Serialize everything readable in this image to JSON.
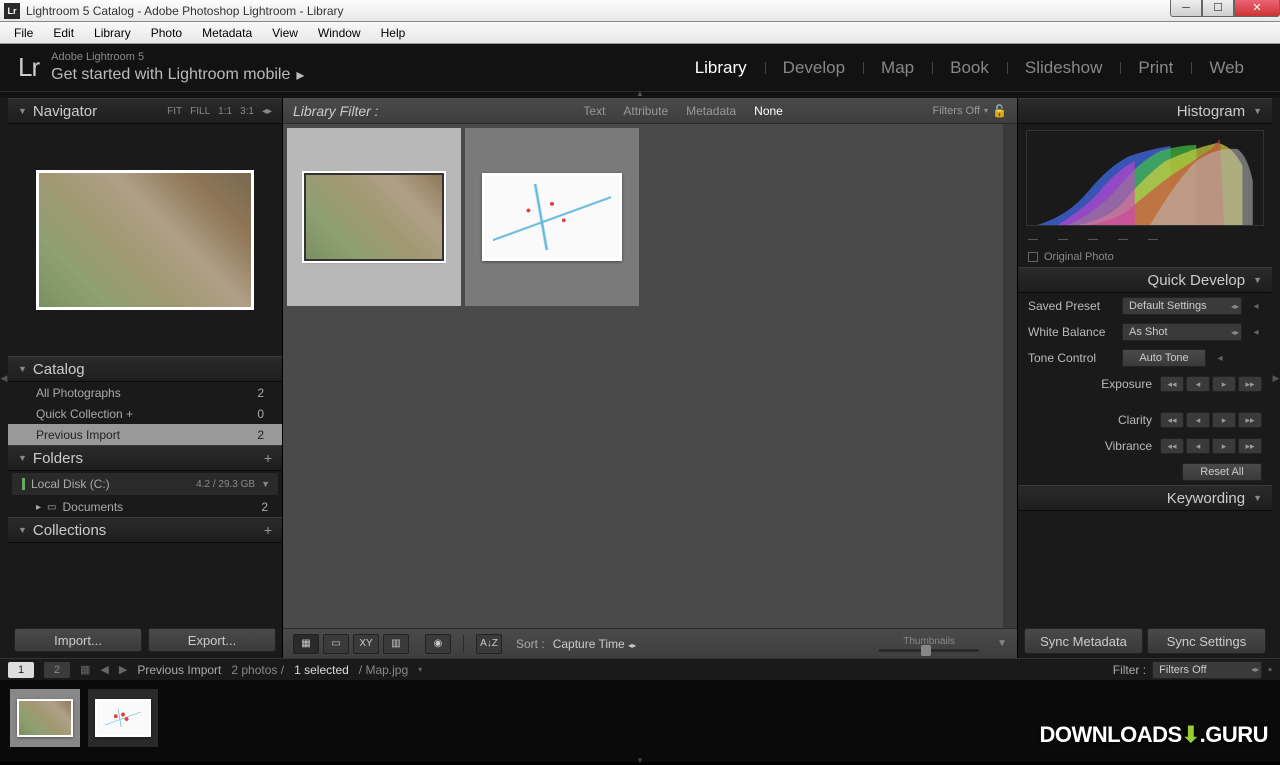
{
  "window": {
    "title": "Lightroom 5 Catalog - Adobe Photoshop Lightroom - Library",
    "lr_badge": "Lr"
  },
  "menu": [
    "File",
    "Edit",
    "Library",
    "Photo",
    "Metadata",
    "View",
    "Window",
    "Help"
  ],
  "header": {
    "logo": "Lr",
    "subtitle": "Adobe Lightroom 5",
    "tagline": "Get started with Lightroom mobile",
    "modules": [
      "Library",
      "Develop",
      "Map",
      "Book",
      "Slideshow",
      "Print",
      "Web"
    ],
    "active_module": "Library"
  },
  "left": {
    "navigator": {
      "title": "Navigator",
      "zoom": [
        "FIT",
        "FILL",
        "1:1",
        "3:1"
      ]
    },
    "catalog": {
      "title": "Catalog",
      "items": [
        {
          "label": "All Photographs",
          "count": "2"
        },
        {
          "label": "Quick Collection  +",
          "count": "0"
        },
        {
          "label": "Previous Import",
          "count": "2"
        }
      ],
      "selected_index": 2
    },
    "folders": {
      "title": "Folders",
      "disk": {
        "label": "Local Disk (C:)",
        "size": "4.2 / 29.3 GB"
      },
      "sub": {
        "label": "Documents",
        "count": "2"
      }
    },
    "collections": {
      "title": "Collections"
    },
    "buttons": {
      "import": "Import...",
      "export": "Export..."
    }
  },
  "filter": {
    "label": "Library Filter :",
    "tabs": [
      "Text",
      "Attribute",
      "Metadata",
      "None"
    ],
    "active": "None",
    "off": "Filters Off"
  },
  "toolbar": {
    "sort_label": "Sort :",
    "sort_value": "Capture Time",
    "thumb_label": "Thumbnails"
  },
  "right": {
    "histogram": {
      "title": "Histogram",
      "original": "Original Photo"
    },
    "quickdev": {
      "title": "Quick Develop",
      "preset_label": "Saved Preset",
      "preset_value": "Default Settings",
      "wb_label": "White Balance",
      "wb_value": "As Shot",
      "tone_label": "Tone Control",
      "auto": "Auto Tone",
      "exposure": "Exposure",
      "clarity": "Clarity",
      "vibrance": "Vibrance",
      "reset": "Reset All"
    },
    "keywording": {
      "title": "Keywording"
    },
    "sync": {
      "metadata": "Sync Metadata",
      "settings": "Sync Settings"
    }
  },
  "status": {
    "page1": "1",
    "page2": "2",
    "breadcrumb": "Previous Import",
    "photos": "2 photos /",
    "selected": "1 selected",
    "file": "/ Map.jpg",
    "filter_label": "Filter :",
    "filter_value": "Filters Off"
  },
  "watermark": {
    "downloads": "DOWNLOADS",
    "guru": ".GURU"
  }
}
